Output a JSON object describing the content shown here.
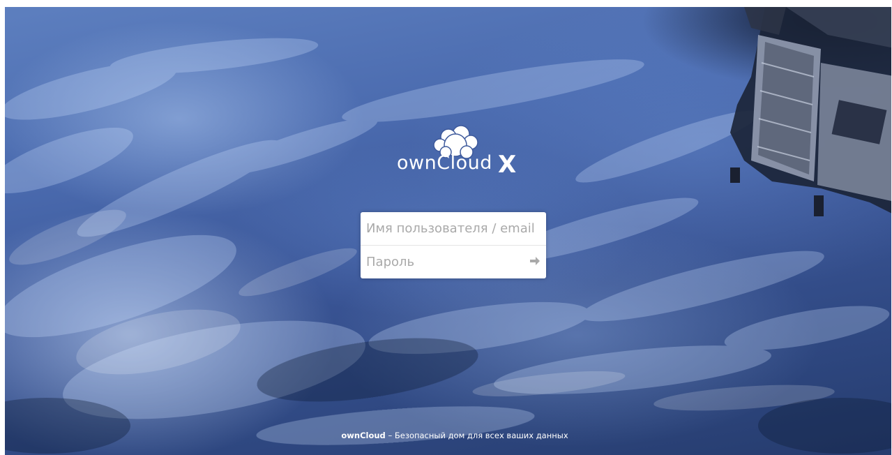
{
  "logo": {
    "wordmark": "ownCloud",
    "suffix": "X"
  },
  "login": {
    "username_placeholder": "Имя пользователя / email",
    "username_value": "",
    "password_placeholder": "Пароль",
    "password_value": ""
  },
  "footer": {
    "brand": "ownCloud",
    "tagline": " – Безопасный дом для всех ваших данных"
  },
  "colors": {
    "background": "#3a5596",
    "form": "#ffffff",
    "placeholder": "#a9a9a9"
  },
  "icons": [
    "owncloud-cloud-icon",
    "submit-arrow-icon"
  ]
}
